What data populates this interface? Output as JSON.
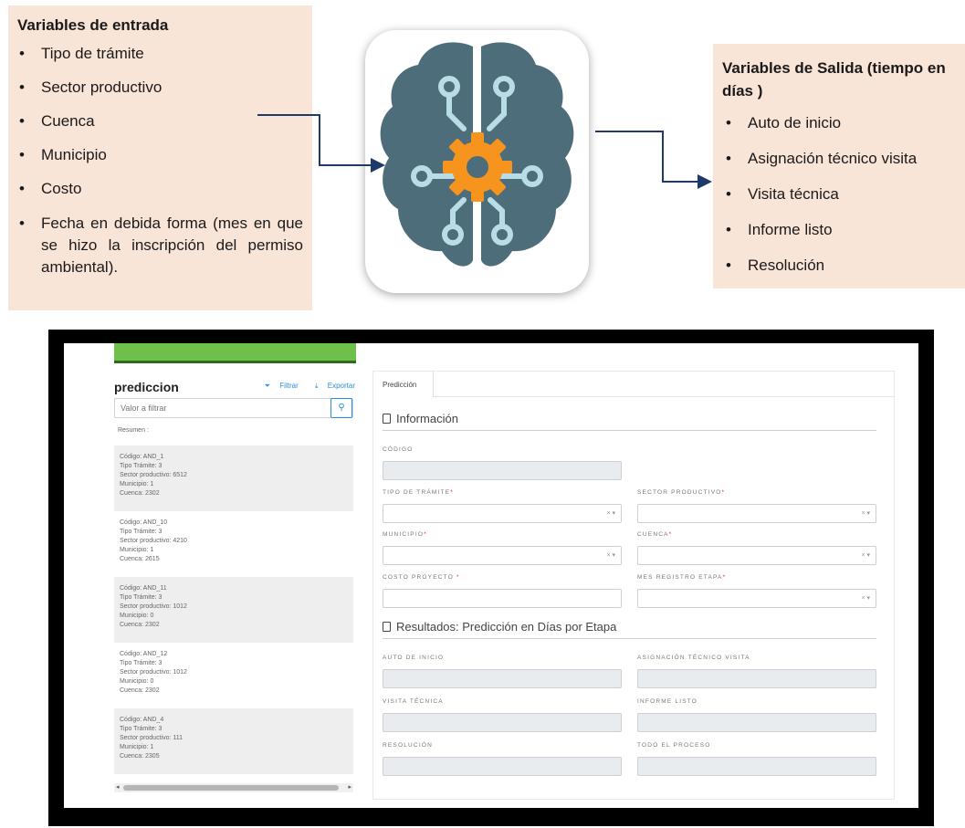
{
  "diagram": {
    "inputs_title": "Variables de entrada",
    "inputs": [
      "Tipo de trámite",
      "Sector productivo",
      "Cuenca",
      "Municipio",
      "Costo",
      "Fecha en debida forma (mes en que se hizo la inscripción del permiso ambiental)."
    ],
    "outputs_title": "Variables de Salida (tiempo en días )",
    "outputs": [
      "Auto de inicio",
      "Asignación técnico visita",
      "Visita técnica",
      "Informe listo",
      "Resolución"
    ],
    "icon": "brain-gear-icon",
    "colors": {
      "box_bg": "#f9e4d8",
      "arrow": "#1f3a68",
      "brain": "#4e6d7a",
      "circuit": "#b8dde6",
      "gear": "#f7941d"
    }
  },
  "app": {
    "left": {
      "title": "prediccion",
      "filter_label": "Filtrar",
      "export_label": "Exportar",
      "filter_placeholder": "Valor a filtrar",
      "summary_label": "Resumen :",
      "records": [
        [
          "Código: AND_1",
          "Tipo Trámite: 3",
          "Sector productivo: 6512",
          "Municipio: 1",
          "Cuenca: 2302"
        ],
        [
          "Código: AND_10",
          "Tipo Trámite: 3",
          "Sector productivo: 4210",
          "Municipio: 1",
          "Cuenca: 2615"
        ],
        [
          "Código: AND_11",
          "Tipo Trámite: 3",
          "Sector productivo: 1012",
          "Municipio: 0",
          "Cuenca: 2302"
        ],
        [
          "Código: AND_12",
          "Tipo Trámite: 3",
          "Sector productivo: 1012",
          "Municipio: 0",
          "Cuenca: 2302"
        ],
        [
          "Código: AND_4",
          "Tipo Trámite: 3",
          "Sector productivo: 111",
          "Municipio: 1",
          "Cuenca: 2305"
        ]
      ]
    },
    "right": {
      "tab": "Predicción",
      "section_info": "Información",
      "section_results": "Resultados: Predicción en Días por Etapa",
      "labels": {
        "codigo": "CÓDIGO",
        "tipo_tramite": "TIPO DE TRÁMITE",
        "sector_productivo": "SECTOR PRODUCTIVO",
        "municipio": "MUNICIPIO",
        "cuenca": "CUENCA",
        "costo_proyecto": "COSTO PROYECTO",
        "mes_registro": "MES REGISTRO ETAPA",
        "auto_inicio": "AUTO DE INICIO",
        "asignacion": "ASIGNACIÓN TÉCNICO VISITA",
        "visita": "VISITA TÉCNICA",
        "informe": "INFORME LISTO",
        "resolucion": "RESOLUCIÓN",
        "todo_proceso": "TODO EL PROCESO"
      },
      "required_mark": "*",
      "select_controls": "× ▾"
    }
  }
}
